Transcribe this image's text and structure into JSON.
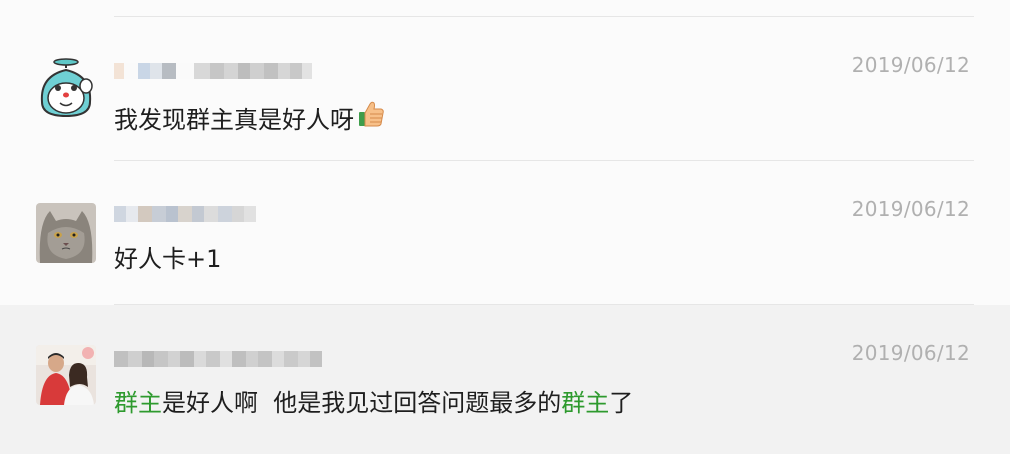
{
  "comments": [
    {
      "date": "2019/06/12",
      "message": "我发现群主真是好人呀",
      "emoji_icon": "thumbs-up-icon"
    },
    {
      "date": "2019/06/12",
      "message": "好人卡+1"
    },
    {
      "date": "2019/06/12",
      "message_parts": [
        {
          "text": "群主",
          "highlight": true
        },
        {
          "text": "是好人啊  他是我见过回答问题最多的",
          "highlight": false
        },
        {
          "text": "群主",
          "highlight": true
        },
        {
          "text": "了",
          "highlight": false
        }
      ]
    }
  ],
  "colors": {
    "highlight": "#2e9a2e",
    "date": "#b0b0b0",
    "separator": "#e6e6e6",
    "selected_row_bg": "#f2f2f2"
  }
}
